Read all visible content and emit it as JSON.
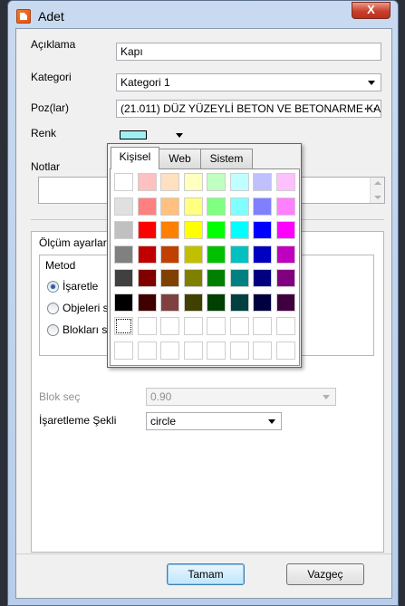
{
  "window": {
    "title": "Adet",
    "close_label": "X"
  },
  "form": {
    "aciklama": {
      "label": "Açıklama",
      "value": "Kapı"
    },
    "kategori": {
      "label": "Kategori",
      "value": "Kategori 1"
    },
    "poz": {
      "label": "Poz(lar)",
      "value": "(21.011) DÜZ YÜZEYLİ BETON VE BETONARME KA...",
      "browse_label": "···"
    },
    "renk": {
      "label": "Renk",
      "selected_color": "#9ff0f5"
    },
    "notlar": {
      "label": "Notlar",
      "value": ""
    }
  },
  "olcum": {
    "title": "Ölçüm ayarları",
    "metod": {
      "title": "Metod",
      "options": [
        {
          "label": "İşaretle",
          "checked": true
        },
        {
          "label": "Objeleri s",
          "checked": false
        },
        {
          "label": "Blokları s",
          "checked": false
        }
      ]
    },
    "blok_sec": {
      "label": "Blok seç",
      "value": "0.90",
      "disabled": true
    },
    "isaretleme_sekli": {
      "label": "İşaretleme Şekli",
      "value": "circle"
    }
  },
  "buttons": {
    "ok": "Tamam",
    "cancel": "Vazgeç"
  },
  "color_popup": {
    "tabs": [
      "Kişisel",
      "Web",
      "Sistem"
    ],
    "active_tab": 0,
    "palette": [
      [
        "#ffffff",
        "#ffc0c0",
        "#ffe0c0",
        "#ffffc0",
        "#c0ffc0",
        "#c0ffff",
        "#c0c0ff",
        "#ffc0ff"
      ],
      [
        "#e0e0e0",
        "#ff8080",
        "#ffc080",
        "#ffff80",
        "#80ff80",
        "#80ffff",
        "#8080ff",
        "#ff80ff"
      ],
      [
        "#c0c0c0",
        "#ff0000",
        "#ff8000",
        "#ffff00",
        "#00ff00",
        "#00ffff",
        "#0000ff",
        "#ff00ff"
      ],
      [
        "#808080",
        "#c00000",
        "#c04000",
        "#c0c000",
        "#00c000",
        "#00c0c0",
        "#0000c0",
        "#c000c0"
      ],
      [
        "#404040",
        "#800000",
        "#804000",
        "#808000",
        "#008000",
        "#008080",
        "#000080",
        "#800080"
      ],
      [
        "#000000",
        "#400000",
        "#804040",
        "#404000",
        "#004000",
        "#004040",
        "#000040",
        "#400040"
      ],
      [
        "#ffffff",
        "#ffffff",
        "#ffffff",
        "#ffffff",
        "#ffffff",
        "#ffffff",
        "#ffffff",
        "#ffffff"
      ],
      [
        "#ffffff",
        "#ffffff",
        "#ffffff",
        "#ffffff",
        "#ffffff",
        "#ffffff",
        "#ffffff",
        "#ffffff"
      ]
    ]
  }
}
